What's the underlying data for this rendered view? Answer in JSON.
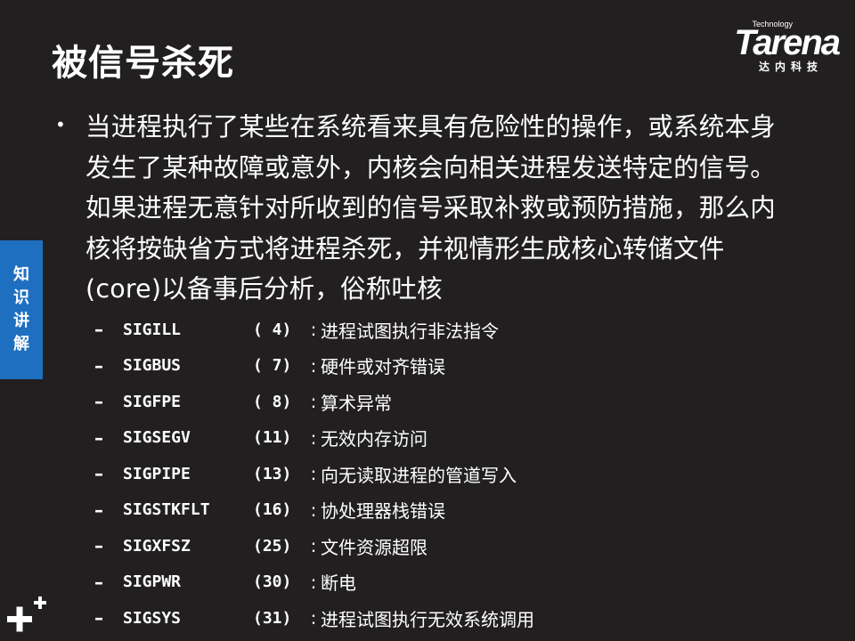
{
  "slide": {
    "title": "被信号杀死",
    "side_tab": "知\n识\n讲\n解",
    "bullet": "当进程执行了某些在系统看来具有危险性的操作，或系统本身发生了某种故障或意外，内核会向相关进程发送特定的信号。如果进程无意针对所收到的信号采取补救或预防措施，那么内核将按缺省方式将进程杀死，并视情形生成核心转储文件(core)以备事后分析，俗称吐核",
    "signals": [
      {
        "dash": "–",
        "name": "SIGILL",
        "num": "( 4)",
        "colon": ":",
        "desc": "进程试图执行非法指令"
      },
      {
        "dash": "–",
        "name": "SIGBUS",
        "num": "( 7)",
        "colon": ":",
        "desc": "硬件或对齐错误"
      },
      {
        "dash": "–",
        "name": "SIGFPE",
        "num": "( 8)",
        "colon": ":",
        "desc": "算术异常"
      },
      {
        "dash": "–",
        "name": "SIGSEGV",
        "num": "(11)",
        "colon": ":",
        "desc": "无效内存访问"
      },
      {
        "dash": "–",
        "name": "SIGPIPE",
        "num": "(13)",
        "colon": ":",
        "desc": "向无读取进程的管道写入"
      },
      {
        "dash": "–",
        "name": "SIGSTKFLT",
        "num": "(16)",
        "colon": ":",
        "desc": "协处理器栈错误"
      },
      {
        "dash": "–",
        "name": "SIGXFSZ",
        "num": "(25)",
        "colon": ":",
        "desc": "文件资源超限"
      },
      {
        "dash": "–",
        "name": "SIGPWR",
        "num": "(30)",
        "colon": ":",
        "desc": "断电"
      },
      {
        "dash": "–",
        "name": "SIGSYS",
        "num": "(31)",
        "colon": ":",
        "desc": "进程试图执行无效系统调用"
      }
    ]
  },
  "logo": {
    "brand": "Tarena",
    "tagline": "Technology",
    "cn": "达内科技"
  },
  "icons": {
    "plus": "plus-icon"
  },
  "colors": {
    "background": "#221f20",
    "side_tab": "#1f6fc1",
    "text": "#ffffff"
  }
}
